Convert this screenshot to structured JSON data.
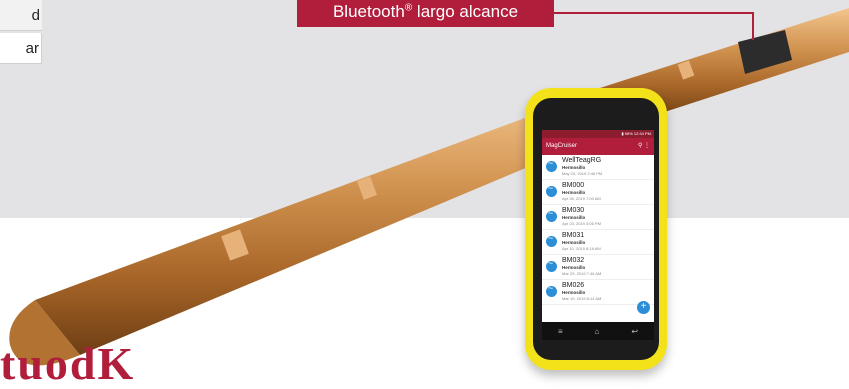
{
  "table": {
    "row1": "d",
    "row2": "ar"
  },
  "callout": {
    "label": "Bluetooth",
    "mark": "®",
    "suffix": " largo alcance"
  },
  "bottom_title": "tuodK",
  "phone": {
    "status_time": "▮ 98% 12:34 PM",
    "app_title": "MagCruiser",
    "appbar_icons": "⚲  ⋮",
    "items": [
      {
        "title": "WellTeagRG",
        "subtitle": "Hermosillo",
        "date": "May 03, 2019 2:48 PM"
      },
      {
        "title": "BM000",
        "subtitle": "Hermosillo",
        "date": "Apr 26, 2019 7:00 AM"
      },
      {
        "title": "BM030",
        "subtitle": "Hermosillo",
        "date": "Apr 23, 2019 3:06 PM"
      },
      {
        "title": "BM031",
        "subtitle": "Hermosillo",
        "date": "Apr 10, 2019 8:18 AM"
      },
      {
        "title": "BM032",
        "subtitle": "Hermosillo",
        "date": "Mar 29, 2019 7:46 AM"
      },
      {
        "title": "BM026",
        "subtitle": "Hermosillo",
        "date": "Mar 19, 2019 8:14 AM"
      }
    ],
    "fab": "+",
    "nav": {
      "menu": "≡",
      "home": "⌂",
      "back": "↩"
    }
  },
  "colors": {
    "accent": "#b01e3c",
    "probe": "#c98a47",
    "phone_case": "#f3e21a"
  }
}
